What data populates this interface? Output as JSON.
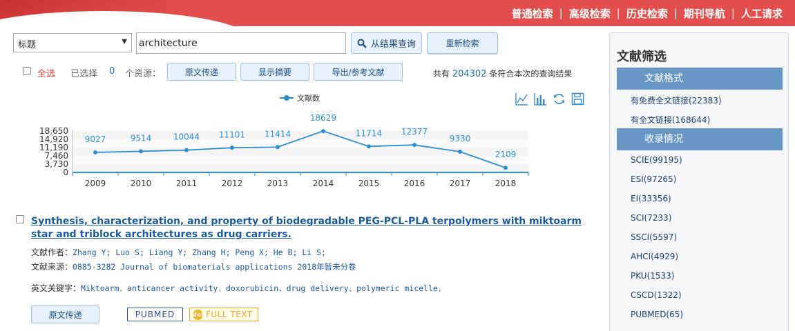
{
  "top_nav": [
    "普通检索",
    "高级检索",
    "历史检索",
    "期刊导航",
    "人工请求"
  ],
  "search": {
    "field": "标题",
    "query": "architecture",
    "search_in_results_label": "从结果查询",
    "reset_label": "重新检索"
  },
  "toolbar": {
    "select_all": "全选",
    "selected_label": "已选择",
    "selected_count": "0",
    "resources_label": "个资源：",
    "delivery_label": "原文传递",
    "abstract_label": "显示摘要",
    "export_label": "导出/参考文献",
    "total_prefix": "共有",
    "total_count": "204302",
    "total_suffix": "条符合本次的查询结果"
  },
  "chart_data": {
    "type": "line",
    "legend": "文献数",
    "categories": [
      "2009",
      "2010",
      "2011",
      "2012",
      "2013",
      "2014",
      "2015",
      "2016",
      "2017",
      "2018"
    ],
    "values": [
      9027,
      9514,
      10044,
      11101,
      11414,
      18629,
      11714,
      12377,
      9330,
      2109
    ],
    "y_ticks": [
      "18,650",
      "14,920",
      "11,190",
      "7,460",
      "3,730",
      "0"
    ],
    "ylim": [
      0,
      18650
    ],
    "color": "#2a8fcf"
  },
  "result": {
    "title": "Synthesis, characterization, and property of biodegradable PEG-PCL-PLA terpolymers with miktoarm star and triblock architectures as drug carriers.",
    "authors_label": "文献作者：",
    "authors": "Zhang Y; Luo S; Liang Y; Zhang H; Peng X; He B; Li S;",
    "source_label": "文献来源：",
    "source": "0885-3282 Journal of biomaterials applications 2018年暂未分卷",
    "keywords_label": "英文关键字：",
    "keywords": "Miktoarm．anticancer activity．doxorubicin．drug delivery．polymeric micelle．",
    "delivery_label": "原文传递",
    "pubmed_label": "PUBMED",
    "fulltext_label": "FULL TEXT",
    "doi_icon_text": "doi"
  },
  "sidebar": {
    "title": "文献筛选",
    "format_header": "文献格式",
    "format_items": [
      "有免费全文链接(22383)",
      "有全文链接(168644)"
    ],
    "index_header": "收录情况",
    "index_items": [
      "SCIE(99195)",
      "ESI(97265)",
      "EI(33356)",
      "SCI(7233)",
      "SSCI(5597)",
      "AHCI(4929)",
      "PKU(1533)",
      "CSCD(1322)",
      "PUBMED(65)"
    ]
  }
}
